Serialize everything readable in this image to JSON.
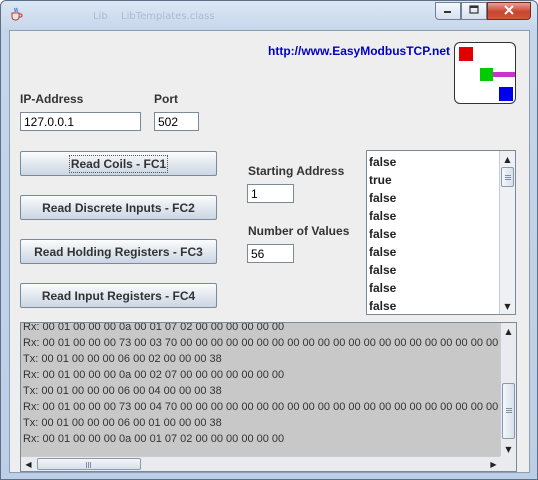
{
  "window": {
    "background_app_text": [
      "Lib",
      "LibTemplates.class"
    ]
  },
  "header": {
    "url": "http://www.EasyModbusTCP.net",
    "logo_colors": [
      "#e10000",
      "#00cc00",
      "#cc33cc",
      "#0000ee"
    ]
  },
  "connection": {
    "ip_label": "IP-Address",
    "ip_value": "127.0.0.1",
    "port_label": "Port",
    "port_value": "502"
  },
  "buttons": {
    "read_coils": "Read Coils - FC1",
    "read_discrete": "Read Discrete Inputs - FC2",
    "read_holding": "Read Holding Registers - FC3",
    "read_input": "Read Input Registers - FC4"
  },
  "params": {
    "start_label": "Starting Address",
    "start_value": "1",
    "count_label": "Number of Values",
    "count_value": "56"
  },
  "values_list": [
    "false",
    "true",
    "false",
    "false",
    "false",
    "false",
    "false",
    "false",
    "false"
  ],
  "log_lines": [
    "Rx: 00 01 00 00 00 0a 00 01 07 02 00 00 00 00 00 00",
    "Rx: 00 01 00 00 00 73 00 03 70 00 00 00 00 00 00 00 00 00 00 00 00 00 00 00 00 00 00 00 00 00 00",
    "Tx: 00 01 00 00 00 06 00 02 00 00 00 38",
    "Rx: 00 01 00 00 00 0a 00 02 07 00 00 00 00 00 00 00",
    "Tx: 00 01 00 00 00 06 00 04 00 00 00 38",
    "Rx: 00 01 00 00 00 73 00 04 70 00 00 00 00 00 00 00 00 00 00 00 00 00 00 00 00 00 00 00 00 00 00",
    "Tx: 00 01 00 00 00 06 00 01 00 00 00 38",
    "Rx: 00 01 00 00 00 0a 00 01 07 02 00 00 00 00 00 00"
  ],
  "icons": {
    "app": "java-cup-icon",
    "minimize": "minimize-icon",
    "maximize": "maximize-icon",
    "close": "close-icon"
  }
}
